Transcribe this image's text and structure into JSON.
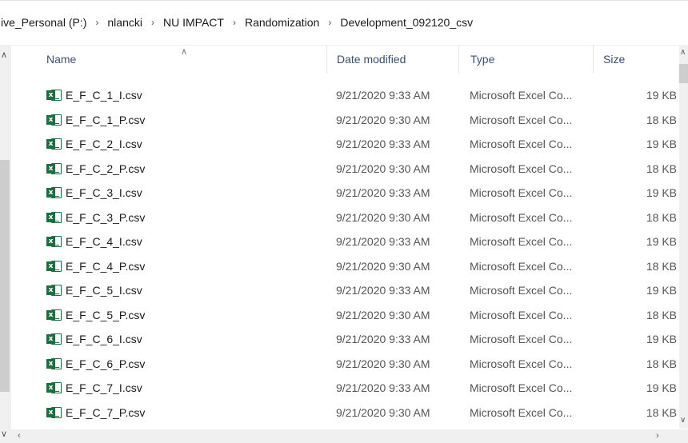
{
  "breadcrumb": [
    "ive_Personal (P:)",
    "nlancki",
    "NU IMPACT",
    "Randomization",
    "Development_092120_csv"
  ],
  "columns": {
    "name": "Name",
    "date": "Date modified",
    "type": "Type",
    "size": "Size"
  },
  "files": [
    {
      "name": "E_F_C_1_I.csv",
      "date": "9/21/2020 9:33 AM",
      "type": "Microsoft Excel Co...",
      "size": "19 KB",
      "icon": "excel-csv-icon"
    },
    {
      "name": "E_F_C_1_P.csv",
      "date": "9/21/2020 9:30 AM",
      "type": "Microsoft Excel Co...",
      "size": "18 KB",
      "icon": "excel-csv-icon"
    },
    {
      "name": "E_F_C_2_I.csv",
      "date": "9/21/2020 9:33 AM",
      "type": "Microsoft Excel Co...",
      "size": "19 KB",
      "icon": "excel-csv-icon"
    },
    {
      "name": "E_F_C_2_P.csv",
      "date": "9/21/2020 9:30 AM",
      "type": "Microsoft Excel Co...",
      "size": "18 KB",
      "icon": "excel-csv-icon"
    },
    {
      "name": "E_F_C_3_I.csv",
      "date": "9/21/2020 9:33 AM",
      "type": "Microsoft Excel Co...",
      "size": "19 KB",
      "icon": "excel-csv-icon"
    },
    {
      "name": "E_F_C_3_P.csv",
      "date": "9/21/2020 9:30 AM",
      "type": "Microsoft Excel Co...",
      "size": "18 KB",
      "icon": "excel-csv-icon"
    },
    {
      "name": "E_F_C_4_I.csv",
      "date": "9/21/2020 9:33 AM",
      "type": "Microsoft Excel Co...",
      "size": "19 KB",
      "icon": "excel-csv-icon"
    },
    {
      "name": "E_F_C_4_P.csv",
      "date": "9/21/2020 9:30 AM",
      "type": "Microsoft Excel Co...",
      "size": "18 KB",
      "icon": "excel-csv-icon"
    },
    {
      "name": "E_F_C_5_I.csv",
      "date": "9/21/2020 9:33 AM",
      "type": "Microsoft Excel Co...",
      "size": "19 KB",
      "icon": "excel-csv-icon"
    },
    {
      "name": "E_F_C_5_P.csv",
      "date": "9/21/2020 9:30 AM",
      "type": "Microsoft Excel Co...",
      "size": "18 KB",
      "icon": "excel-csv-icon"
    },
    {
      "name": "E_F_C_6_I.csv",
      "date": "9/21/2020 9:33 AM",
      "type": "Microsoft Excel Co...",
      "size": "19 KB",
      "icon": "excel-csv-icon"
    },
    {
      "name": "E_F_C_6_P.csv",
      "date": "9/21/2020 9:30 AM",
      "type": "Microsoft Excel Co...",
      "size": "18 KB",
      "icon": "excel-csv-icon"
    },
    {
      "name": "E_F_C_7_I.csv",
      "date": "9/21/2020 9:33 AM",
      "type": "Microsoft Excel Co...",
      "size": "19 KB",
      "icon": "excel-csv-icon"
    },
    {
      "name": "E_F_C_7_P.csv",
      "date": "9/21/2020 9:30 AM",
      "type": "Microsoft Excel Co...",
      "size": "18 KB",
      "icon": "excel-csv-icon"
    }
  ],
  "icons": {
    "breadcrumb_separator": "chevron-right-icon",
    "sort": "sort-ascending-icon",
    "scroll_up": "chevron-up-icon",
    "scroll_down": "chevron-down-icon",
    "scroll_left": "chevron-left-icon",
    "scroll_right": "chevron-right-icon"
  },
  "colors": {
    "header_text": "#3b4f73",
    "excel_green": "#1d6f42",
    "scroll_track": "#f0f0f0",
    "scroll_thumb": "#cdcdcd"
  }
}
